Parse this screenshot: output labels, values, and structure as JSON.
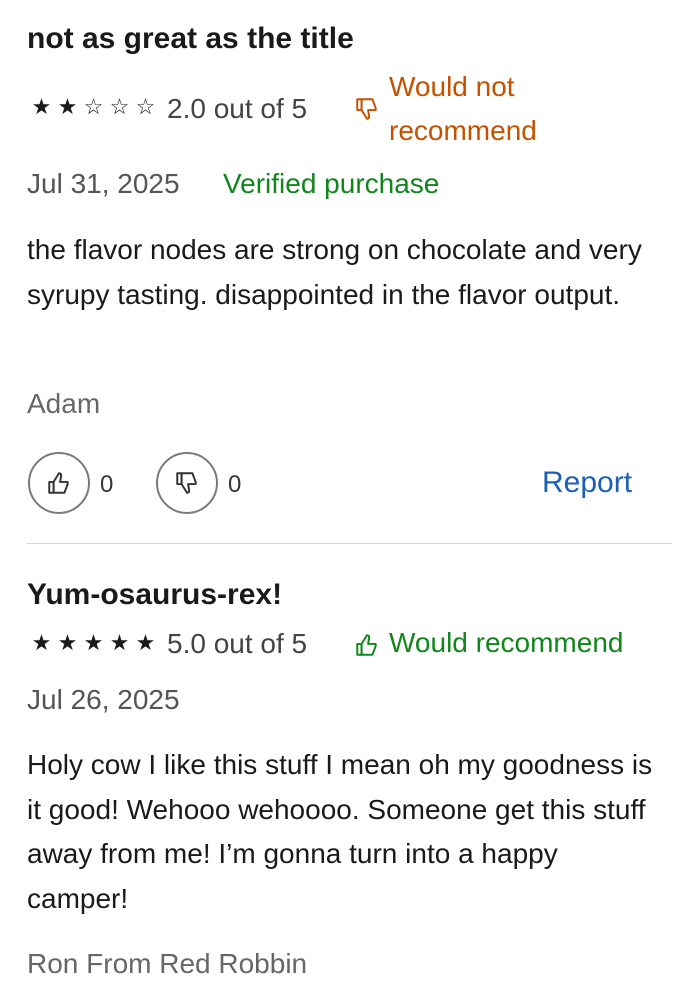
{
  "colors": {
    "negative": "#c55200",
    "positive": "#10861c",
    "link": "#1c5fb3",
    "text": "#1a1a1a"
  },
  "reviews": [
    {
      "title": "not as great as the title",
      "rating": 2,
      "rating_text": "2.0 out of 5",
      "recommendation_icon": "thumbs-down-icon",
      "recommendation_line1": "Would not",
      "recommendation_line2": "recommend",
      "date": "Jul 31, 2025",
      "verified": "Verified purchase",
      "body": "the flavor nodes are strong on chocolate and very syrupy tasting. disappointed in the flavor output.",
      "author": "Adam",
      "helpful_count": "0",
      "unhelpful_count": "0",
      "report_label": "Report"
    },
    {
      "title": "Yum-osaurus-rex!",
      "rating": 5,
      "rating_text": "5.0 out of 5",
      "recommendation_icon": "thumbs-up-icon",
      "recommendation": "Would recommend",
      "date": "Jul 26, 2025",
      "body": "Holy cow I like this stuff I mean oh my goodness is it good! Wehooo wehoooo. Someone get this stuff away from me! I’m gonna turn into a happy camper!",
      "author": "Ron From Red Robbin"
    }
  ]
}
